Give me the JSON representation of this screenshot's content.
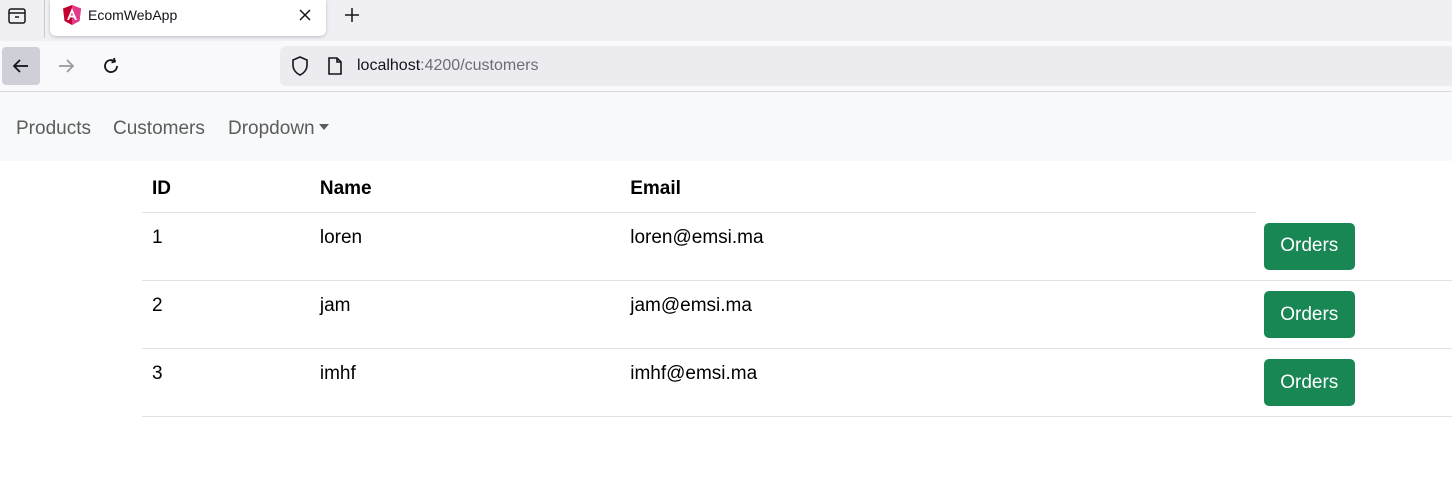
{
  "browser": {
    "tab": {
      "title": "EcomWebApp"
    },
    "url": {
      "host": "localhost",
      "rest": ":4200/customers"
    }
  },
  "nav": {
    "links": [
      "Products",
      "Customers"
    ],
    "dropdown": "Dropdown"
  },
  "table": {
    "headers": {
      "id": "ID",
      "name": "Name",
      "email": "Email"
    },
    "rows": [
      {
        "id": "1",
        "name": "loren",
        "email": "loren@emsi.ma",
        "button": "Orders"
      },
      {
        "id": "2",
        "name": "jam",
        "email": "jam@emsi.ma",
        "button": "Orders"
      },
      {
        "id": "3",
        "name": "imhf",
        "email": "imhf@emsi.ma",
        "button": "Orders"
      }
    ]
  },
  "colors": {
    "button": "#198754",
    "navbar": "#f8f9fa"
  }
}
